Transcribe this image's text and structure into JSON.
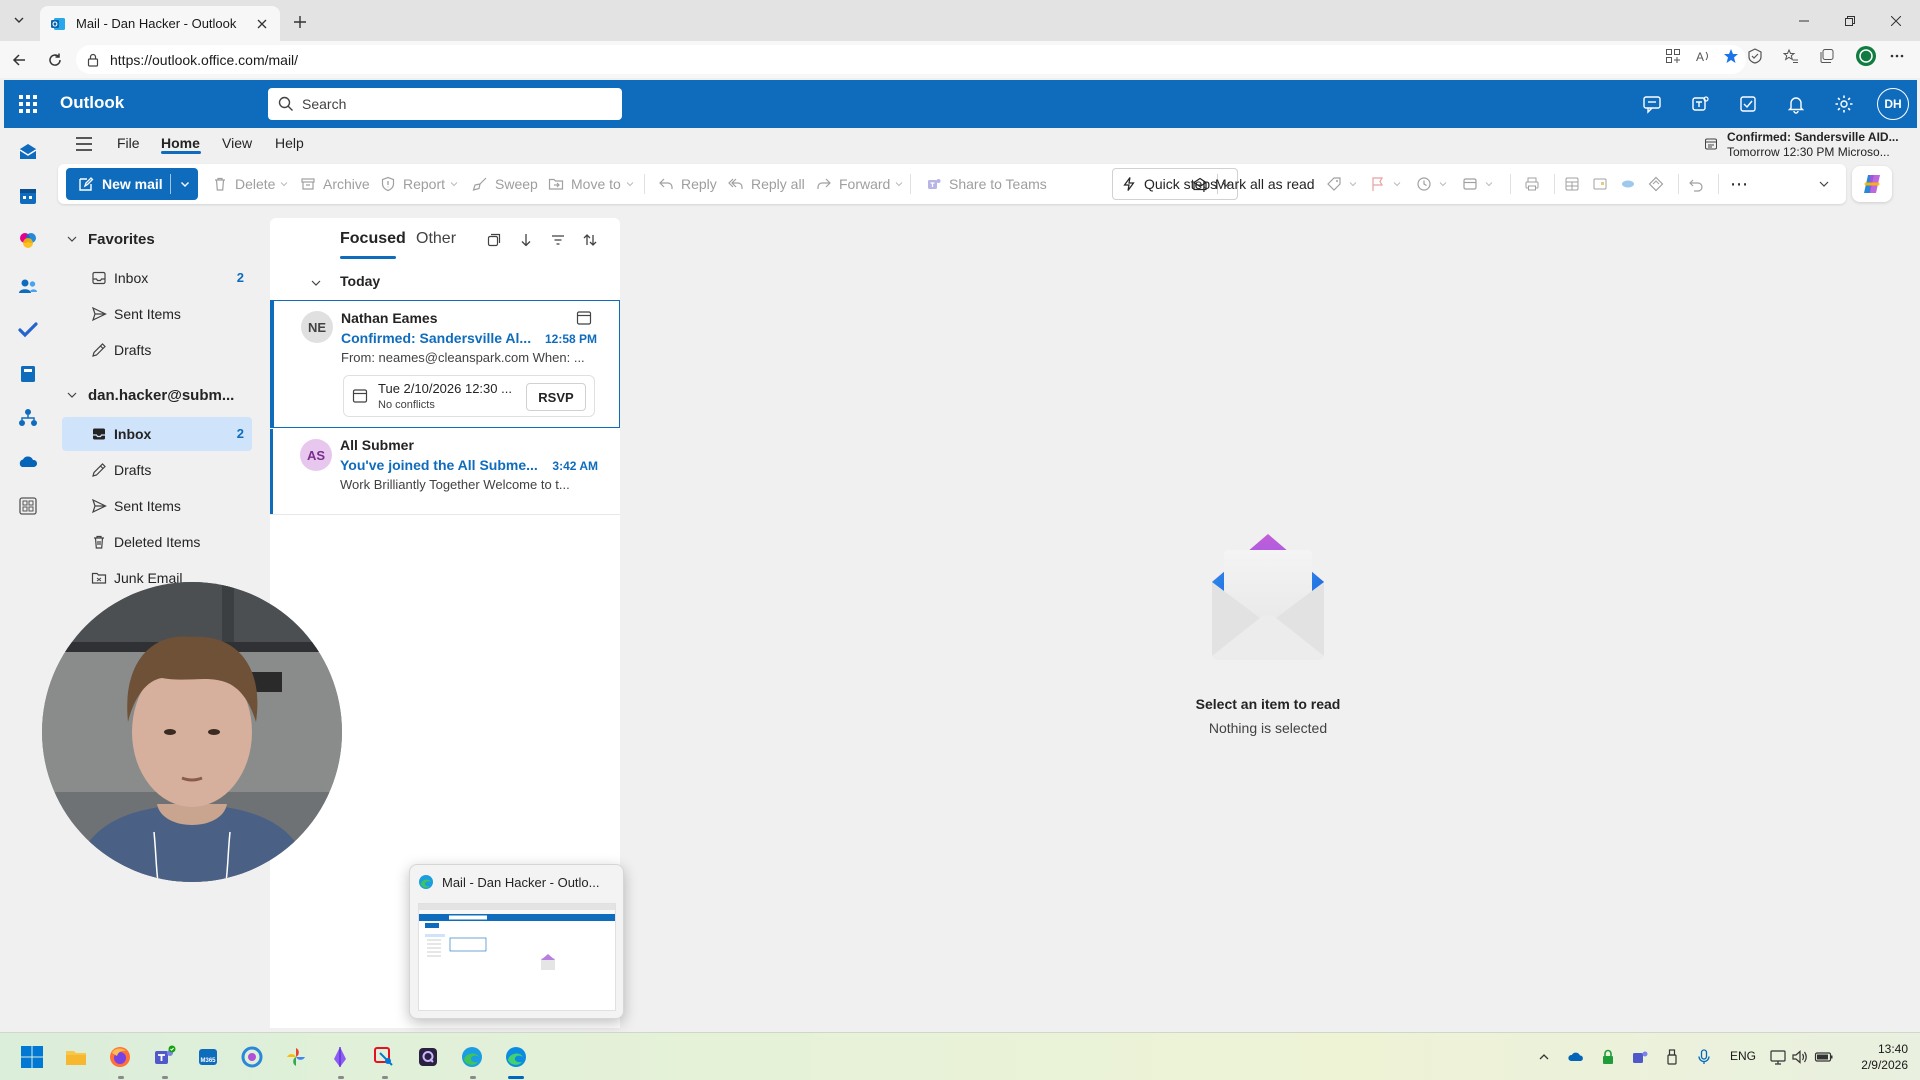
{
  "browser": {
    "tab_title": "Mail - Dan Hacker - Outlook",
    "url": "https://outlook.office.com/mail/"
  },
  "header": {
    "app_name": "Outlook",
    "search_placeholder": "Search",
    "avatar_initials": "DH",
    "brand_color": "#0f6cbd"
  },
  "menu": {
    "tabs": [
      "File",
      "Home",
      "View",
      "Help"
    ],
    "active_tab": "Home"
  },
  "reminder": {
    "title": "Confirmed: Sandersville AID...",
    "detail": "Tomorrow 12:30 PM Microso..."
  },
  "ribbon": {
    "new_mail": "New mail",
    "delete": "Delete",
    "archive": "Archive",
    "report": "Report",
    "sweep": "Sweep",
    "move_to": "Move to",
    "reply": "Reply",
    "reply_all": "Reply all",
    "forward": "Forward",
    "share_to_teams": "Share to Teams",
    "quick_steps": "Quick steps",
    "mark_all_read": "Mark all as read",
    "more": "⋯"
  },
  "folders": {
    "favorites_label": "Favorites",
    "favorites": [
      {
        "label": "Inbox",
        "count": "2",
        "icon": "inbox-icon"
      },
      {
        "label": "Sent Items",
        "count": "",
        "icon": "send-icon"
      },
      {
        "label": "Drafts",
        "count": "",
        "icon": "drafts-icon"
      }
    ],
    "account_label": "dan.hacker@subm...",
    "account": [
      {
        "label": "Inbox",
        "count": "2",
        "icon": "inbox-icon"
      },
      {
        "label": "Drafts",
        "count": "",
        "icon": "drafts-icon"
      },
      {
        "label": "Sent Items",
        "count": "",
        "icon": "send-icon"
      },
      {
        "label": "Deleted Items",
        "count": "",
        "icon": "trash-icon"
      },
      {
        "label": "Junk Email",
        "count": "",
        "icon": "junk-icon"
      }
    ]
  },
  "message_list": {
    "pivot_focused": "Focused",
    "pivot_other": "Other",
    "group_today": "Today",
    "messages": [
      {
        "initials": "NE",
        "sender": "Nathan Eames",
        "subject": "Confirmed: Sandersville Al...",
        "time": "12:58 PM",
        "preview": "From: neames@cleanspark.com When: ...",
        "invite_time": "Tue 2/10/2026 12:30 ...",
        "invite_status": "No conflicts",
        "rsvp": "RSVP"
      },
      {
        "initials": "AS",
        "sender": "All Submer",
        "subject": "You've joined the All Subme...",
        "time": "3:42 AM",
        "preview": "Work Brilliantly Together Welcome to t..."
      }
    ]
  },
  "reading_pane": {
    "title": "Select an item to read",
    "subtitle": "Nothing is selected"
  },
  "thumbnail": {
    "title": "Mail - Dan Hacker - Outlo..."
  },
  "taskbar": {
    "language": "ENG",
    "time": "13:40",
    "date": "2/9/2026"
  }
}
